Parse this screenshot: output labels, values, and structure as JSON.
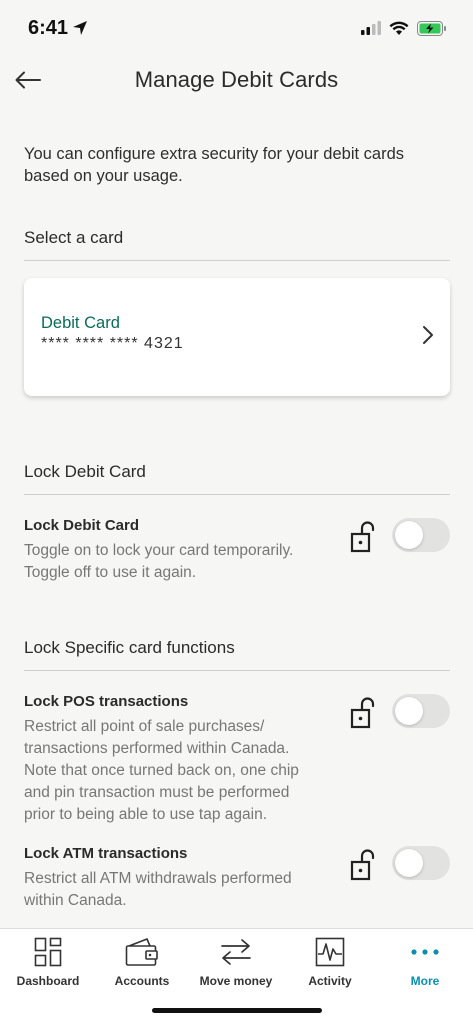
{
  "status_bar": {
    "time": "6:41"
  },
  "header": {
    "title": "Manage Debit Cards"
  },
  "intro": "You can configure extra security for your debit cards based on your usage.",
  "select_section": {
    "title": "Select a card"
  },
  "card": {
    "name": "Debit Card",
    "number": "**** **** **** 4321"
  },
  "lock_section": {
    "title": "Lock Debit Card",
    "setting": {
      "title": "Lock Debit Card",
      "description": "Toggle on to lock your card temporarily. Toggle off to use it again.",
      "enabled": false
    }
  },
  "functions_section": {
    "title": "Lock Specific card functions",
    "pos": {
      "title": "Lock POS transactions",
      "description": "Restrict all point of sale purchases/ transactions performed within Canada. Note that once turned back on, one chip and pin transaction must be performed prior to being able to use tap again.",
      "enabled": false
    },
    "atm": {
      "title": "Lock ATM transactions",
      "description": "Restrict all ATM withdrawals performed within Canada.",
      "enabled": false
    }
  },
  "nav": {
    "dashboard": "Dashboard",
    "accounts": "Accounts",
    "move_money": "Move money",
    "activity": "Activity",
    "more": "More"
  },
  "colors": {
    "accent": "#0b6b5a",
    "active_nav": "#0a8fb0",
    "background": "#f6f6f4"
  }
}
